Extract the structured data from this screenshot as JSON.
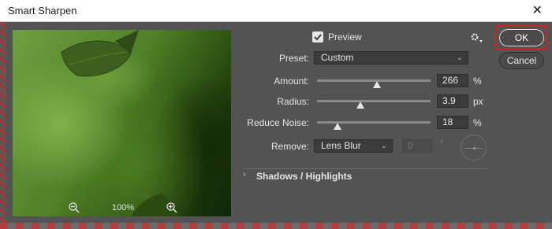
{
  "window": {
    "title": "Smart Sharpen",
    "close_glyph": "✕"
  },
  "preview_pane": {
    "zoom_out_icon": "zoom-out-icon",
    "zoom_level": "100%",
    "zoom_in_icon": "zoom-in-icon"
  },
  "options": {
    "preview_label": "Preview",
    "preview_checked": true,
    "settings_icon": "gear-icon",
    "preset_label": "Preset:",
    "preset_value": "Custom",
    "amount_label": "Amount:",
    "amount_value": "266",
    "amount_unit": "%",
    "amount_fraction": 0.53,
    "radius_label": "Radius:",
    "radius_value": "3.9",
    "radius_unit": "px",
    "radius_fraction": 0.38,
    "noise_label": "Reduce Noise:",
    "noise_value": "18",
    "noise_unit": "%",
    "noise_fraction": 0.18,
    "remove_label": "Remove:",
    "remove_value": "Lens Blur",
    "angle_value": "0",
    "angle_unit": "°",
    "shadows_highlights_label": "Shadows / Highlights"
  },
  "buttons": {
    "ok_label": "OK",
    "cancel_label": "Cancel"
  },
  "colors": {
    "dialog_bg": "#535353",
    "highlight_border": "#c0282d"
  }
}
